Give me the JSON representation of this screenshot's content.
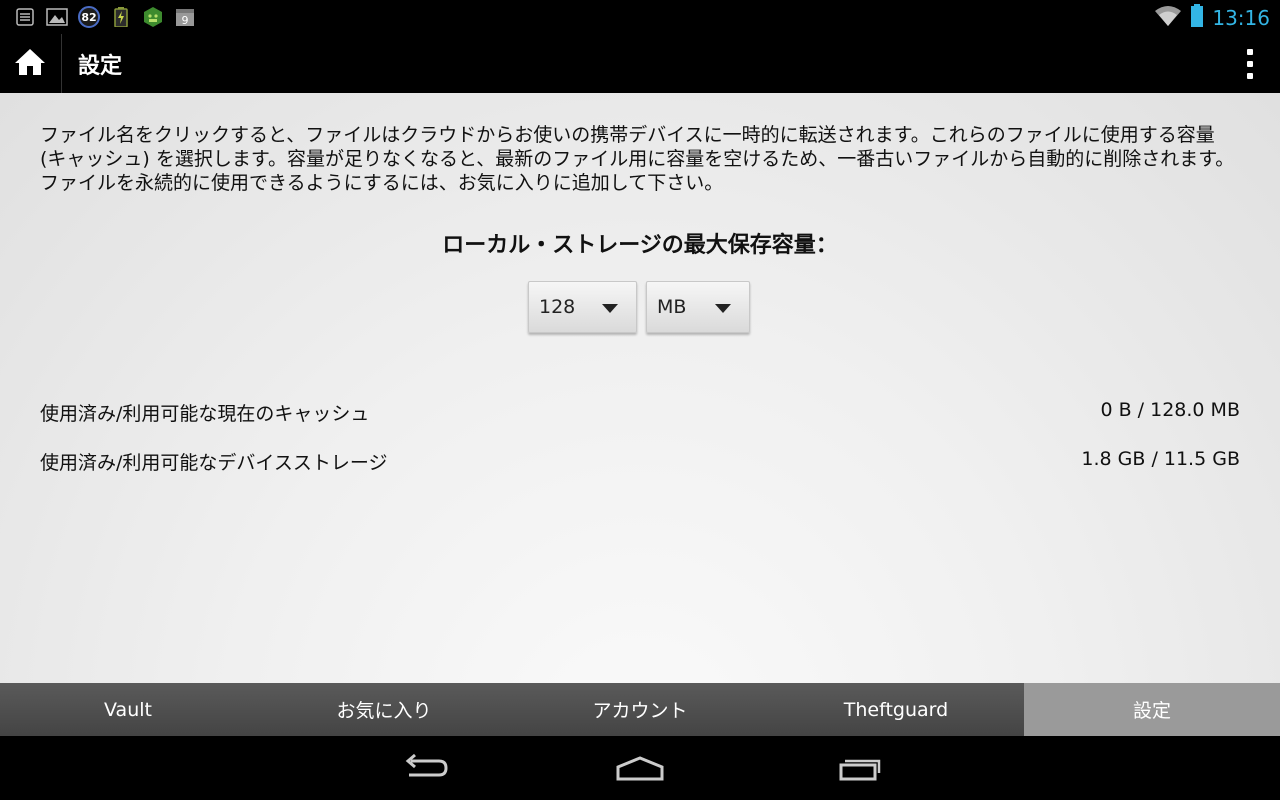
{
  "status_bar": {
    "notification_icons": [
      "checklist-icon",
      "image-icon",
      "battery-level-badge-icon",
      "battery-charging-icon",
      "android-badge-icon",
      "calendar-icon"
    ],
    "badge_value": "82",
    "calendar_day": "9",
    "time": "13:16"
  },
  "action_bar": {
    "title": "設定"
  },
  "content": {
    "description": "ファイル名をクリックすると、ファイルはクラウドからお使いの携帯デバイスに一時的に転送されます。これらのファイルに使用する容量 (キャッシュ) を選択します。容量が足りなくなると、最新のファイル用に容量を空けるため、一番古いファイルから自動的に削除されます。ファイルを永続的に使用できるようにするには、お気に入りに追加して下さい。",
    "heading": "ローカル・ストレージの最大保存容量：",
    "size_select": "128",
    "unit_select": "MB",
    "cache_label": "使用済み/利用可能な現在のキャッシュ",
    "cache_value": "0 B / 128.0 MB",
    "device_label": "使用済み/利用可能なデバイスストレージ",
    "device_value": "1.8 GB / 11.5 GB"
  },
  "tabs": [
    {
      "label": "Vault"
    },
    {
      "label": "お気に入り"
    },
    {
      "label": "アカウント"
    },
    {
      "label": "Theftguard"
    },
    {
      "label": "設定"
    }
  ],
  "colors": {
    "accent_time": "#33b5e5",
    "active_tab": "#9a9a9a"
  }
}
